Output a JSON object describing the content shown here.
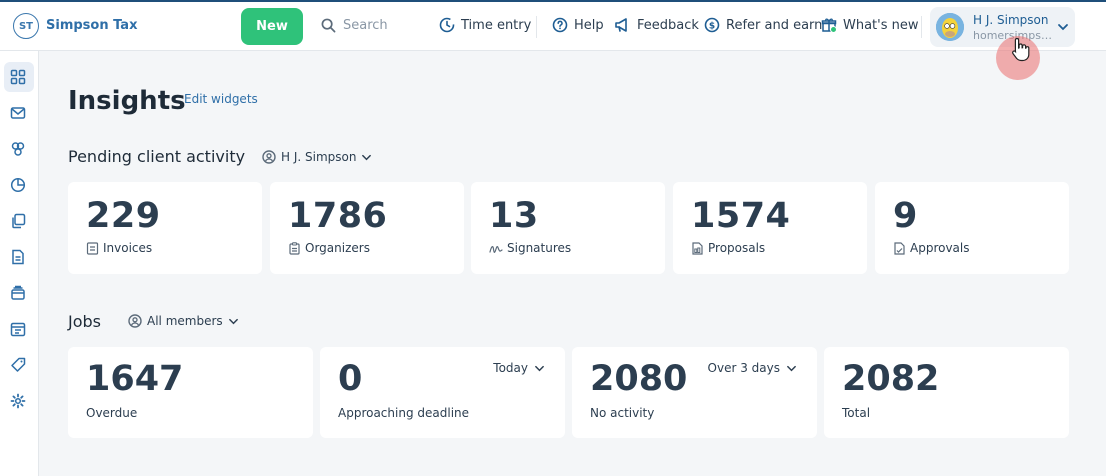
{
  "brand": {
    "logo_text": "ST",
    "name": "Simpson Tax"
  },
  "topbar": {
    "new_label": "New",
    "search_placeholder": "Search",
    "time_entry": "Time entry",
    "help": "Help",
    "feedback": "Feedback",
    "refer": "Refer and earn",
    "whats_new": "What's new",
    "user_name": "H J. Simpson",
    "user_email": "homersimpso…"
  },
  "page": {
    "title": "Insights",
    "edit_widgets": "Edit widgets"
  },
  "pending": {
    "title": "Pending client activity",
    "filter": "H J. Simpson",
    "cards": [
      {
        "value": "229",
        "label": "Invoices"
      },
      {
        "value": "1786",
        "label": "Organizers"
      },
      {
        "value": "13",
        "label": "Signatures"
      },
      {
        "value": "1574",
        "label": "Proposals"
      },
      {
        "value": "9",
        "label": "Approvals"
      }
    ]
  },
  "jobs": {
    "title": "Jobs",
    "filter": "All members",
    "cards": [
      {
        "value": "1647",
        "label": "Overdue"
      },
      {
        "value": "0",
        "label": "Approaching deadline",
        "dropdown": "Today"
      },
      {
        "value": "2080",
        "label": "No activity",
        "dropdown": "Over 3 days"
      },
      {
        "value": "2082",
        "label": "Total"
      }
    ]
  },
  "colors": {
    "accent": "#2f6fa8",
    "new_button": "#2fc27a",
    "background": "#f4f6f8"
  }
}
